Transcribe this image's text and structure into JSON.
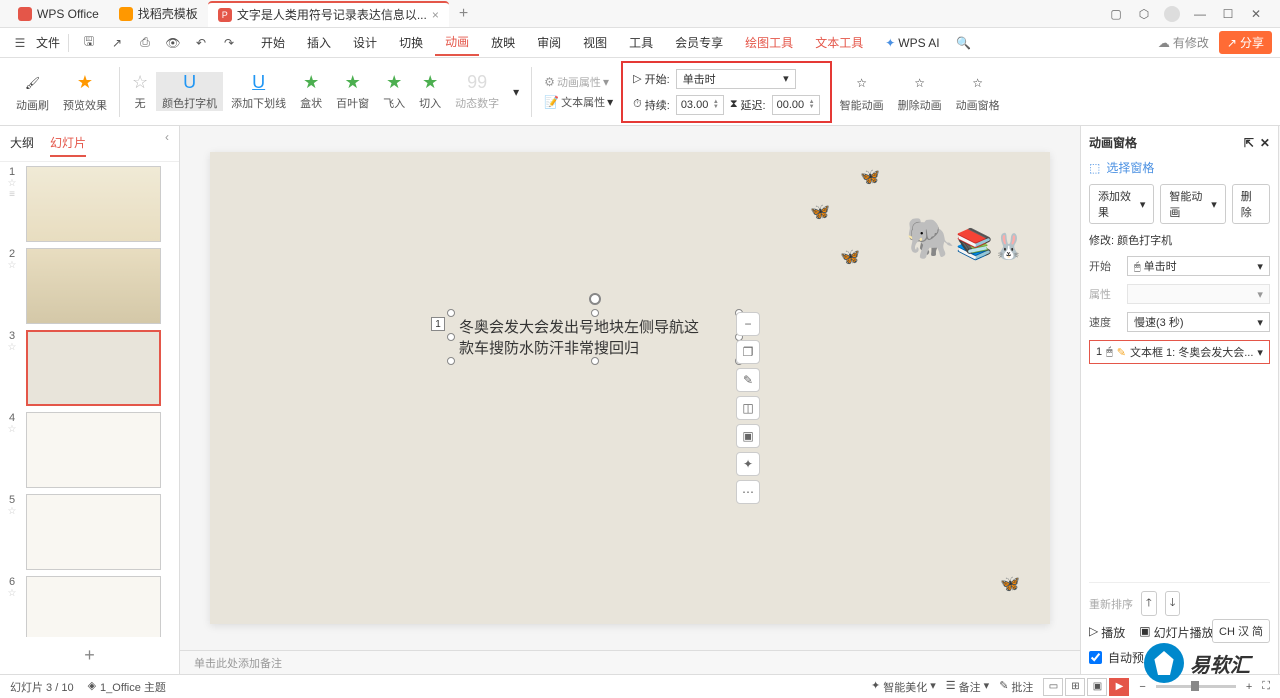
{
  "title_bar": {
    "wps_office": "WPS Office",
    "tab_templates": "找稻壳模板",
    "tab_doc": "文字是人类用符号记录表达信息以...",
    "tab_doc_close": "×",
    "new_tab": "+"
  },
  "menu": {
    "file": "文件",
    "tabs": {
      "start": "开始",
      "insert": "插入",
      "design": "设计",
      "transition": "切换",
      "animation": "动画",
      "slideshow": "放映",
      "review": "审阅",
      "view": "视图",
      "tools": "工具",
      "member": "会员专享",
      "drawing_tools": "绘图工具",
      "text_tools": "文本工具",
      "wps_ai": "WPS AI"
    },
    "has_modify": "有修改",
    "share": "分享"
  },
  "ribbon": {
    "anim_brush": "动画刷",
    "preview_effect": "预览效果",
    "none": "无",
    "color_typewriter": "颜色打字机",
    "add_underline": "添加下划线",
    "box": "盒状",
    "blinds": "百叶窗",
    "fly_in": "飞入",
    "cut_in": "切入",
    "dynamic_num": "动态数字",
    "anim_props": "动画属性",
    "text_props": "文本属性",
    "start_label": "开始:",
    "start_value": "单击时",
    "duration_label": "持续:",
    "duration_value": "03.00",
    "delay_label": "延迟:",
    "delay_value": "00.00",
    "smart_anim": "智能动画",
    "delete_anim": "删除动画",
    "anim_pane": "动画窗格"
  },
  "left_pane": {
    "outline": "大纲",
    "slides": "幻灯片",
    "new": "+"
  },
  "canvas": {
    "text_line1": "冬奥会发大会发出号地块左侧导航这",
    "text_line2": "款车搜防水防汗非常搜回归",
    "seq": "1",
    "notes_placeholder": "单击此处添加备注"
  },
  "anim_panel": {
    "title": "动画窗格",
    "select_pane": "选择窗格",
    "add_effect": "添加效果",
    "smart_anim": "智能动画",
    "delete": "删除",
    "modify": "修改: 颜色打字机",
    "start": "开始",
    "start_val": "单击时",
    "property": "属性",
    "speed": "速度",
    "speed_val": "慢速(3 秒)",
    "item_num": "1",
    "item_text": "文本框 1: 冬奥会发大会...",
    "reorder": "重新排序",
    "play": "播放",
    "slideshow_play": "幻灯片播放",
    "auto_preview": "自动预"
  },
  "status": {
    "slide_pos": "幻灯片 3 / 10",
    "theme": "1_Office 主题",
    "smart_beautify": "智能美化",
    "notes": "备注",
    "comments": "批注"
  },
  "lang_badge": "CH 汉 简",
  "brand_text": "易软汇"
}
